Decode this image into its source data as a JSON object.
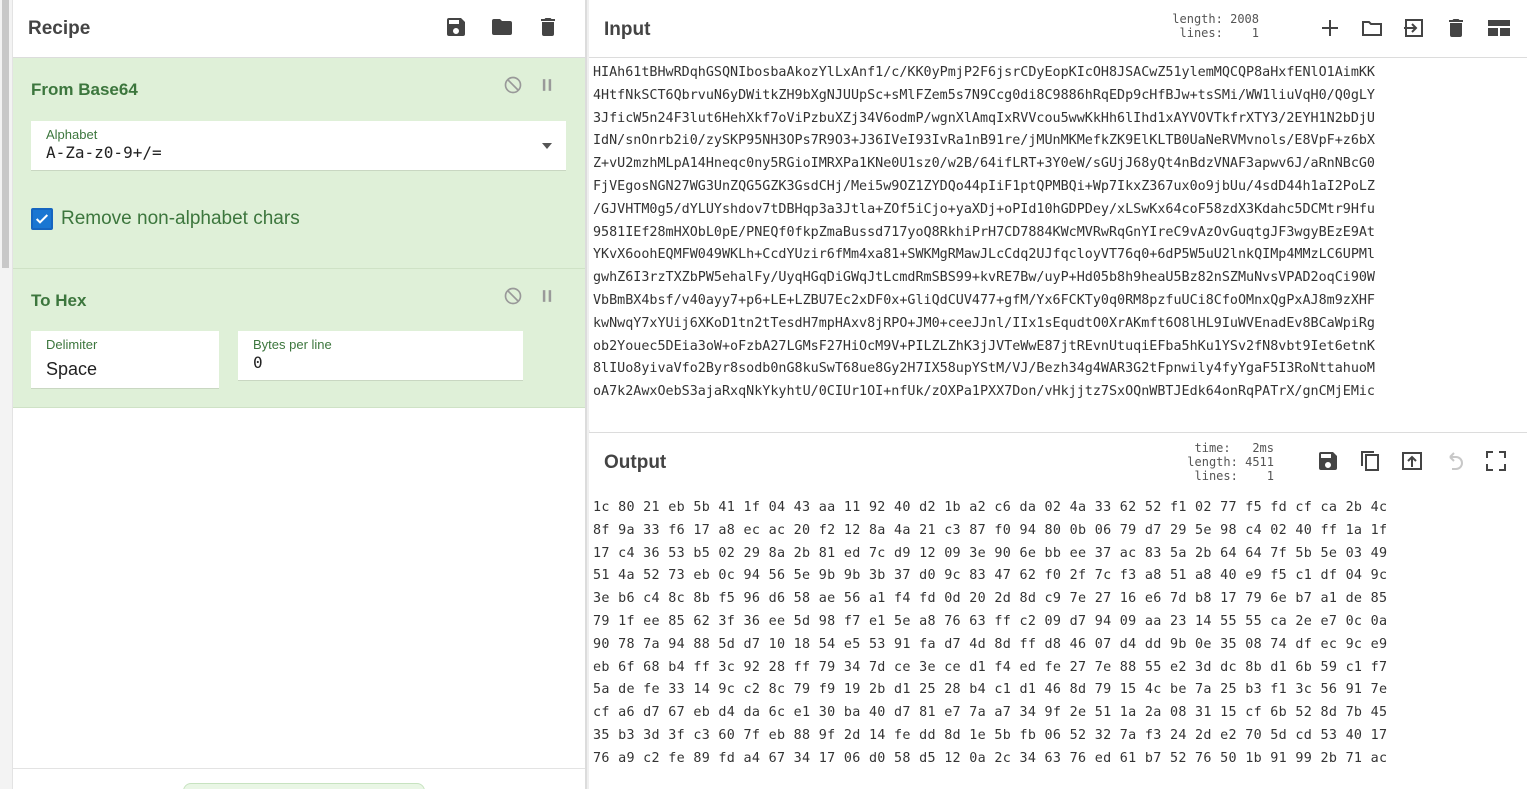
{
  "recipe": {
    "title": "Recipe",
    "actions": [
      {
        "name": "save-recipe-button",
        "icon": "save-icon"
      },
      {
        "name": "load-recipe-button",
        "icon": "folder-icon"
      },
      {
        "name": "clear-recipe-button",
        "icon": "trash-icon"
      }
    ],
    "operations": [
      {
        "title": "From Base64",
        "alphabet_label": "Alphabet",
        "alphabet_value": "A-Za-z0-9+/=",
        "checkbox_label": "Remove non-alphabet chars",
        "checkbox_checked": true
      },
      {
        "title": "To Hex",
        "delimiter_label": "Delimiter",
        "delimiter_value": "Space",
        "bytes_label": "Bytes per line",
        "bytes_value": "0"
      }
    ]
  },
  "input": {
    "title": "Input",
    "length_label": "length:",
    "length_value": "2008",
    "lines_label": "lines:",
    "lines_value": "1",
    "lines": [
      "HIAh61tBHwRDqhGSQNIbosbaAkozYlLxAnf1/c/KK0yPmjP2F6jsrCDyEopKIcOH8JSACwZ51ylemMQCQP8aHxfENlO1AimKK",
      "4HtfNkSCT6QbrvuN6yDWitkZH9bXgNJUUpSc+sMlFZem5s7N9Ccg0di8C9886hRqEDp9cHfBJw+tsSMi/WW1liuVqH0/Q0gLY",
      "3JficW5n24F3lut6HehXkf7oViPzbuXZj34V6odmP/wgnXlAmqIxRVVcou5wwKkHh6lIhd1xAYVOVTkfrXTY3/2EYH1N2bDjU",
      "IdN/snOnrb2i0/zySKP95NH3OPs7R9O3+J36IVeI93IvRa1nB91re/jMUnMKMefkZK9ElKLTB0UaNeRVMvnols/E8VpF+z6bX",
      "Z+vU2mzhMLpA14Hneqc0ny5RGioIMRXPa1KNe0U1sz0/w2B/64ifLRT+3Y0eW/sGUjJ68yQt4nBdzVNAF3apwv6J/aRnNBcG0",
      "FjVEgosNGN27WG3UnZQG5GZK3GsdCHj/Mei5w9OZ1ZYDQo44pIiF1ptQPMBQi+Wp7IkxZ367ux0o9jbUu/4sdD44h1aI2PoLZ",
      "/GJVHTM0g5/dYLUYshdov7tDBHqp3a3Jtla+ZOf5iCjo+yaXDj+oPId10hGDPDey/xLSwKx64coF58zdX3Kdahc5DCMtr9Hfu",
      "9581IEf28mHXObL0pE/PNEQf0fkpZmaBussd717yoQ8RkhiPrH7CD7884KWcMVRwRqGnYIreC9vAzOvGuqtgJF3wgyBEzE9At",
      "YKvX6oohEQMFW049WKLh+CcdYUzir6fMm4xa81+SWKMgRMawJLcCdq2UJfqcloyVT76q0+6dP5W5uU2lnkQIMp4MMzLC6UPMl",
      "gwhZ6I3rzTXZbPW5ehalFy/UyqHGqDiGWqJtLcmdRmSBS99+kvRE7Bw/uyP+Hd05b8h9heaU5Bz82nSZMuNvsVPAD2oqCi90W",
      "VbBmBX4bsf/v40ayy7+p6+LE+LZBU7Ec2xDF0x+GliQdCUV477+gfM/Yx6FCKTy0q0RM8pzfuUCi8CfoOMnxQgPxAJ8m9zXHF",
      "kwNwqY7xYUij6XKoD1tn2tTesdH7mpHAxv8jRPO+JM0+ceeJJnl/IIx1sEqudtO0XrAKmft6O8lHL9IuWVEnadEv8BCaWpiRg",
      "ob2Youec5DEia3oW+oFzbA27LGMsF27HiOcM9V+PILZLZhK3jJVTeWwE87jtREvnUtuqiEFba5hKu1YSv2fN8vbt9Iet6etnK",
      "8lIUo8yivaVfo2Byr8sodb0nG8kuSwT68ue8Gy2H7IX58upYStM/VJ/Bezh34g4WAR3G2tFpnwily4fyYgaF5I3RoNttahuoM",
      "oA7k2AwxOebS3ajaRxqNkYkyhtU/0CIUr1OI+nfUk/zOXPa1PXX7Don/vHkjjtz7SxOQnWBTJEdk64onRqPATrX/gnCMjEMic"
    ]
  },
  "output": {
    "title": "Output",
    "time_label": "time:",
    "time_value": "2ms",
    "length_label": "length:",
    "length_value": "4511",
    "lines_label": "lines:",
    "lines_value": "1",
    "lines": [
      "1c 80 21 eb 5b 41 1f 04 43 aa 11 92 40 d2 1b a2 c6 da 02 4a 33 62 52 f1 02 77 f5 fd cf ca 2b 4c",
      "8f 9a 33 f6 17 a8 ec ac 20 f2 12 8a 4a 21 c3 87 f0 94 80 0b 06 79 d7 29 5e 98 c4 02 40 ff 1a 1f",
      "17 c4 36 53 b5 02 29 8a 2b 81 ed 7c d9 12 09 3e 90 6e bb ee 37 ac 83 5a 2b 64 64 7f 5b 5e 03 49",
      "51 4a 52 73 eb 0c 94 56 5e 9b 9b 3b 37 d0 9c 83 47 62 f0 2f 7c f3 a8 51 a8 40 e9 f5 c1 df 04 9c",
      "3e b6 c4 8c 8b f5 96 d6 58 ae 56 a1 f4 fd 0d 20 2d 8d c9 7e 27 16 e6 7d b8 17 79 6e b7 a1 de 85",
      "79 1f ee 85 62 3f 36 ee 5d 98 f7 e1 5e a8 76 63 ff c2 09 d7 94 09 aa 23 14 55 55 ca 2e e7 0c 0a",
      "90 78 7a 94 88 5d d7 10 18 54 e5 53 91 fa d7 4d 8d ff d8 46 07 d4 dd 9b 0e 35 08 74 df ec 9c e9",
      "eb 6f 68 b4 ff 3c 92 28 ff 79 34 7d ce 3e ce d1 f4 ed fe 27 7e 88 55 e2 3d dc 8b d1 6b 59 c1 f7",
      "5a de fe 33 14 9c c2 8c 79 f9 19 2b d1 25 28 b4 c1 d1 46 8d 79 15 4c be 7a 25 b3 f1 3c 56 91 7e",
      "cf a6 d7 67 eb d4 da 6c e1 30 ba 40 d7 81 e7 7a a7 34 9f 2e 51 1a 2a 08 31 15 cf 6b 52 8d 7b 45",
      "35 b3 3d 3f c3 60 7f eb 88 9f 2d 14 fe dd 8d 1e 5b fb 06 52 32 7a f3 24 2d e2 70 5d cd 53 40 17",
      "76 a9 c2 fe 89 fd a4 67 34 17 06 d0 58 d5 12 0a 2c 34 63 76 ed 61 b7 52 76 50 1b 91 99 2b 71 ac"
    ]
  },
  "colors": {
    "operation_bg": "#dff0d8",
    "operation_text": "#3c763d",
    "checkbox_accent": "#1976d2"
  }
}
